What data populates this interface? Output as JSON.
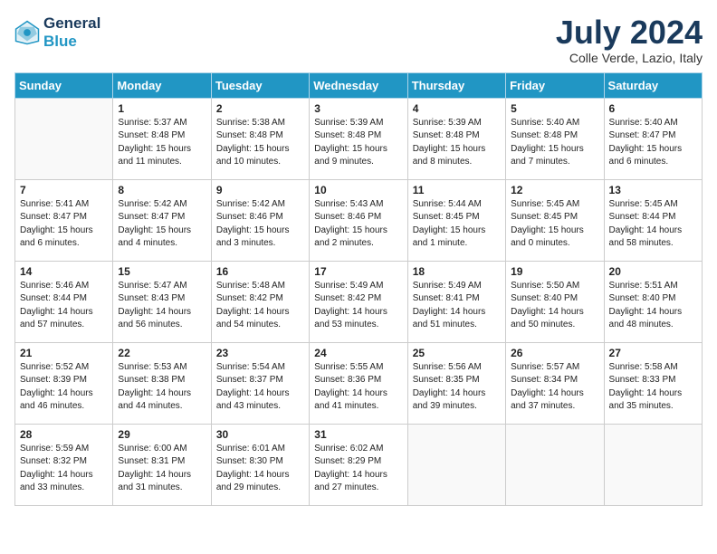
{
  "header": {
    "logo_line1": "General",
    "logo_line2": "Blue",
    "month_year": "July 2024",
    "location": "Colle Verde, Lazio, Italy"
  },
  "days_of_week": [
    "Sunday",
    "Monday",
    "Tuesday",
    "Wednesday",
    "Thursday",
    "Friday",
    "Saturday"
  ],
  "weeks": [
    [
      {
        "day": null
      },
      {
        "day": "1",
        "sunrise": "5:37 AM",
        "sunset": "8:48 PM",
        "daylight": "15 hours and 11 minutes."
      },
      {
        "day": "2",
        "sunrise": "5:38 AM",
        "sunset": "8:48 PM",
        "daylight": "15 hours and 10 minutes."
      },
      {
        "day": "3",
        "sunrise": "5:39 AM",
        "sunset": "8:48 PM",
        "daylight": "15 hours and 9 minutes."
      },
      {
        "day": "4",
        "sunrise": "5:39 AM",
        "sunset": "8:48 PM",
        "daylight": "15 hours and 8 minutes."
      },
      {
        "day": "5",
        "sunrise": "5:40 AM",
        "sunset": "8:48 PM",
        "daylight": "15 hours and 7 minutes."
      },
      {
        "day": "6",
        "sunrise": "5:40 AM",
        "sunset": "8:47 PM",
        "daylight": "15 hours and 6 minutes."
      }
    ],
    [
      {
        "day": "7",
        "sunrise": "5:41 AM",
        "sunset": "8:47 PM",
        "daylight": "15 hours and 6 minutes."
      },
      {
        "day": "8",
        "sunrise": "5:42 AM",
        "sunset": "8:47 PM",
        "daylight": "15 hours and 4 minutes."
      },
      {
        "day": "9",
        "sunrise": "5:42 AM",
        "sunset": "8:46 PM",
        "daylight": "15 hours and 3 minutes."
      },
      {
        "day": "10",
        "sunrise": "5:43 AM",
        "sunset": "8:46 PM",
        "daylight": "15 hours and 2 minutes."
      },
      {
        "day": "11",
        "sunrise": "5:44 AM",
        "sunset": "8:45 PM",
        "daylight": "15 hours and 1 minute."
      },
      {
        "day": "12",
        "sunrise": "5:45 AM",
        "sunset": "8:45 PM",
        "daylight": "15 hours and 0 minutes."
      },
      {
        "day": "13",
        "sunrise": "5:45 AM",
        "sunset": "8:44 PM",
        "daylight": "14 hours and 58 minutes."
      }
    ],
    [
      {
        "day": "14",
        "sunrise": "5:46 AM",
        "sunset": "8:44 PM",
        "daylight": "14 hours and 57 minutes."
      },
      {
        "day": "15",
        "sunrise": "5:47 AM",
        "sunset": "8:43 PM",
        "daylight": "14 hours and 56 minutes."
      },
      {
        "day": "16",
        "sunrise": "5:48 AM",
        "sunset": "8:42 PM",
        "daylight": "14 hours and 54 minutes."
      },
      {
        "day": "17",
        "sunrise": "5:49 AM",
        "sunset": "8:42 PM",
        "daylight": "14 hours and 53 minutes."
      },
      {
        "day": "18",
        "sunrise": "5:49 AM",
        "sunset": "8:41 PM",
        "daylight": "14 hours and 51 minutes."
      },
      {
        "day": "19",
        "sunrise": "5:50 AM",
        "sunset": "8:40 PM",
        "daylight": "14 hours and 50 minutes."
      },
      {
        "day": "20",
        "sunrise": "5:51 AM",
        "sunset": "8:40 PM",
        "daylight": "14 hours and 48 minutes."
      }
    ],
    [
      {
        "day": "21",
        "sunrise": "5:52 AM",
        "sunset": "8:39 PM",
        "daylight": "14 hours and 46 minutes."
      },
      {
        "day": "22",
        "sunrise": "5:53 AM",
        "sunset": "8:38 PM",
        "daylight": "14 hours and 44 minutes."
      },
      {
        "day": "23",
        "sunrise": "5:54 AM",
        "sunset": "8:37 PM",
        "daylight": "14 hours and 43 minutes."
      },
      {
        "day": "24",
        "sunrise": "5:55 AM",
        "sunset": "8:36 PM",
        "daylight": "14 hours and 41 minutes."
      },
      {
        "day": "25",
        "sunrise": "5:56 AM",
        "sunset": "8:35 PM",
        "daylight": "14 hours and 39 minutes."
      },
      {
        "day": "26",
        "sunrise": "5:57 AM",
        "sunset": "8:34 PM",
        "daylight": "14 hours and 37 minutes."
      },
      {
        "day": "27",
        "sunrise": "5:58 AM",
        "sunset": "8:33 PM",
        "daylight": "14 hours and 35 minutes."
      }
    ],
    [
      {
        "day": "28",
        "sunrise": "5:59 AM",
        "sunset": "8:32 PM",
        "daylight": "14 hours and 33 minutes."
      },
      {
        "day": "29",
        "sunrise": "6:00 AM",
        "sunset": "8:31 PM",
        "daylight": "14 hours and 31 minutes."
      },
      {
        "day": "30",
        "sunrise": "6:01 AM",
        "sunset": "8:30 PM",
        "daylight": "14 hours and 29 minutes."
      },
      {
        "day": "31",
        "sunrise": "6:02 AM",
        "sunset": "8:29 PM",
        "daylight": "14 hours and 27 minutes."
      },
      {
        "day": null
      },
      {
        "day": null
      },
      {
        "day": null
      }
    ]
  ]
}
